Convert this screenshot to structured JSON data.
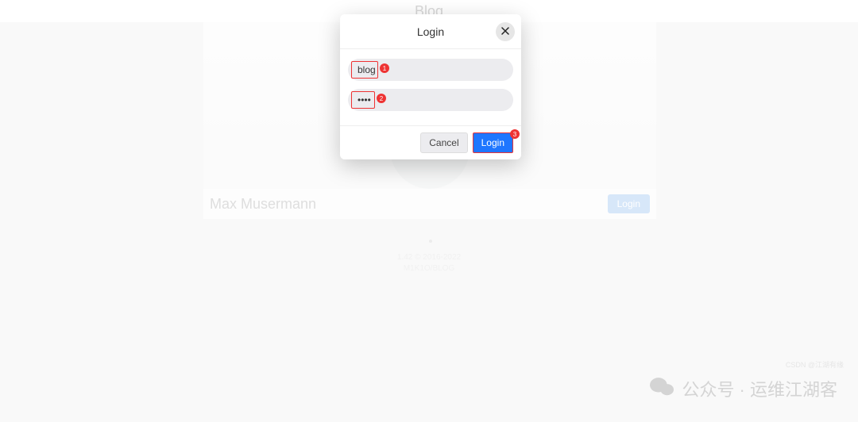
{
  "page": {
    "title": "Blog",
    "author": "Max Musermann",
    "login_label": "Login",
    "footer_line1": "1.42 © 2016-2022",
    "footer_line2": "M1K1O/BLOG"
  },
  "modal": {
    "title": "Login",
    "username": {
      "value": "blog"
    },
    "password": {
      "value": "....",
      "masked": "••••"
    },
    "cancel_label": "Cancel",
    "login_label": "Login"
  },
  "annotations": {
    "n1": "1",
    "n2": "2",
    "n3": "3"
  },
  "watermark": {
    "main": "公众号 · 运维江湖客",
    "small": "CSDN @江湖有缘"
  },
  "colors": {
    "accent": "#1f76ff",
    "highlight": "#e33"
  }
}
